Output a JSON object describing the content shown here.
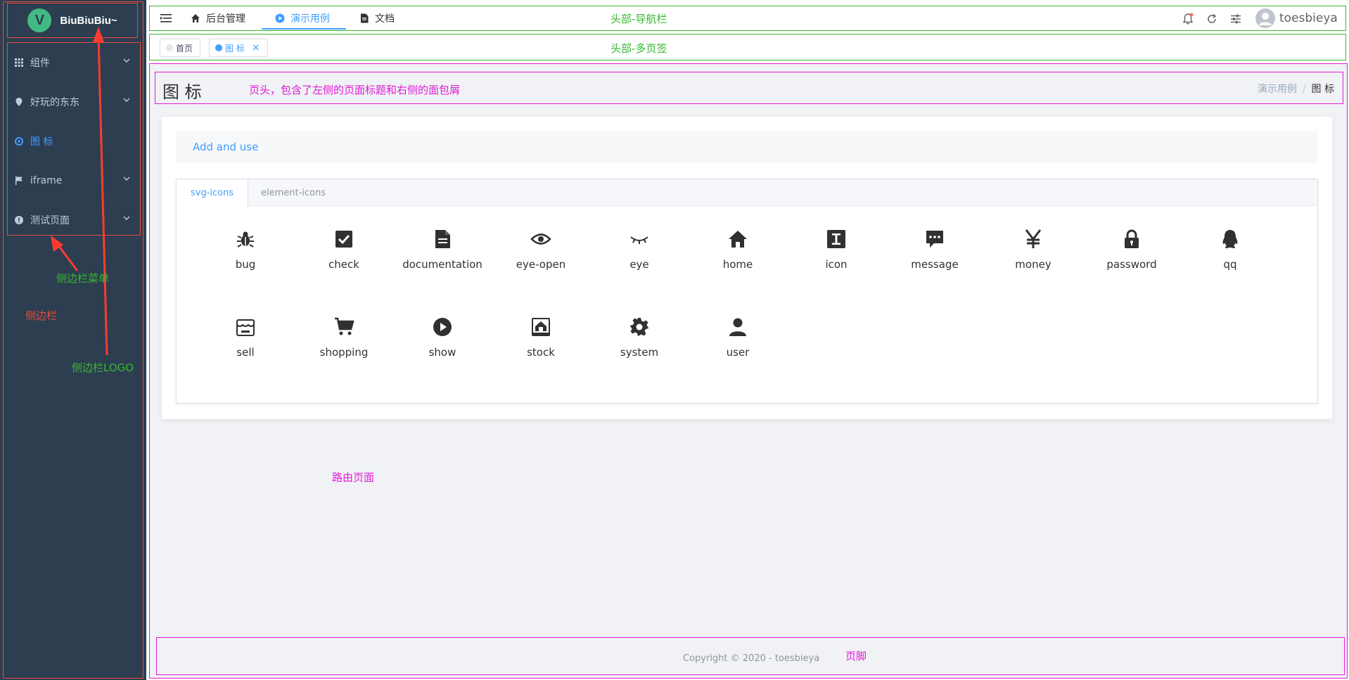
{
  "sidebar": {
    "logo_letter": "V",
    "title": "BiuBiuBiu~",
    "items": [
      {
        "label": "组件",
        "icon": "grid-icon",
        "has_children": true,
        "active": false
      },
      {
        "label": "好玩的东东",
        "icon": "location-icon",
        "has_children": true,
        "active": false
      },
      {
        "label": "图 标",
        "icon": "chrome-icon",
        "has_children": false,
        "active": true
      },
      {
        "label": "iframe",
        "icon": "flag-icon",
        "has_children": true,
        "active": false
      },
      {
        "label": "测试页面",
        "icon": "info-icon",
        "has_children": true,
        "active": false
      }
    ]
  },
  "annotations": {
    "sidebar_menu": "侧边栏菜单",
    "sidebar": "侧边栏",
    "sidebar_logo": "侧边栏LOGO",
    "header_nav": "头部-导航栏",
    "header_tags": "头部-多页签",
    "page_header": "页头，包含了左侧的页面标题和右侧的面包屑",
    "route_page": "路由页面",
    "footer": "页脚"
  },
  "header": {
    "nav": [
      {
        "label": "后台管理",
        "icon": "home-icon",
        "active": false
      },
      {
        "label": "演示用例",
        "icon": "play-circle-icon",
        "active": true
      },
      {
        "label": "文档",
        "icon": "document-icon",
        "active": false
      }
    ],
    "right_icons": [
      "bell-icon",
      "refresh-icon",
      "settings-sliders-icon"
    ],
    "username": "toesbieya"
  },
  "tags": [
    {
      "label": "首页",
      "active": false,
      "closable": false
    },
    {
      "label": "图 标",
      "active": true,
      "closable": true
    }
  ],
  "page": {
    "title": "图 标",
    "breadcrumb": [
      "演示用例",
      "图 标"
    ]
  },
  "card": {
    "head": "Add and use",
    "tabs": [
      {
        "label": "svg-icons",
        "active": true
      },
      {
        "label": "element-icons",
        "active": false
      }
    ],
    "icons": [
      {
        "name": "bug"
      },
      {
        "name": "check"
      },
      {
        "name": "documentation"
      },
      {
        "name": "eye-open"
      },
      {
        "name": "eye"
      },
      {
        "name": "home"
      },
      {
        "name": "icon"
      },
      {
        "name": "message"
      },
      {
        "name": "money"
      },
      {
        "name": "password"
      },
      {
        "name": "qq"
      },
      {
        "name": "sell"
      },
      {
        "name": "shopping"
      },
      {
        "name": "show"
      },
      {
        "name": "stock"
      },
      {
        "name": "system"
      },
      {
        "name": "user"
      }
    ]
  },
  "footer": {
    "copyright": "Copyright © 2020 - toesbieya"
  },
  "colors": {
    "sidebar_bg": "#2c3e50",
    "accent": "#409eff",
    "logo": "#42b983",
    "annotation_green": "#37b830",
    "annotation_red": "#e74c3c",
    "annotation_magenta": "#e21bd6"
  }
}
